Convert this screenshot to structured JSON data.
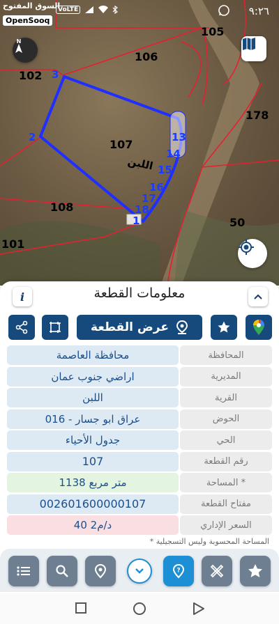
{
  "status_bar": {
    "time": "٩:٢٦",
    "brand_line1": "السوق المفتوح",
    "brand_line2": "OpenSooq",
    "volte": "VoLTE"
  },
  "map": {
    "plot_numbers": [
      "105",
      "106",
      "102",
      "178",
      "107",
      "108",
      "50",
      "101"
    ],
    "area_label": "اللبن",
    "vertices": [
      "3",
      "2",
      "13",
      "14",
      "15",
      "16",
      "17",
      "18",
      "1"
    ],
    "plot_color": "#1f2fff",
    "boundary_color": "#e52030"
  },
  "panel": {
    "title": "معلومات القطعة",
    "info_icon": "i",
    "show_plot_button": "عرض القطعة",
    "rows": [
      {
        "label": "المحافظة",
        "value": "محافظة العاصمة"
      },
      {
        "label": "المديرية",
        "value": "اراضي جنوب عمان"
      },
      {
        "label": "القرية",
        "value": "اللبن"
      },
      {
        "label": "الحوض",
        "value": "عراق ابو جسار - 016"
      },
      {
        "label": "الحي",
        "value": "جدول الأحياء"
      },
      {
        "label": "رقم القطعة",
        "value": "107"
      },
      {
        "label": "المساحة *",
        "value": "1138  متر مربع"
      },
      {
        "label": "مفتاح القطعة",
        "value": "002601600000107"
      },
      {
        "label": "السعر الإداري",
        "value": "40 د/م2"
      }
    ],
    "footnote": "* المساحة المحسوبة وليس التسجيلية"
  },
  "colors": {
    "primary": "#174a7c",
    "accent": "#1d8fd4",
    "value_bg": "#dde9f3",
    "area_bg": "#e3f4e0",
    "price_bg": "#fadfe2"
  }
}
